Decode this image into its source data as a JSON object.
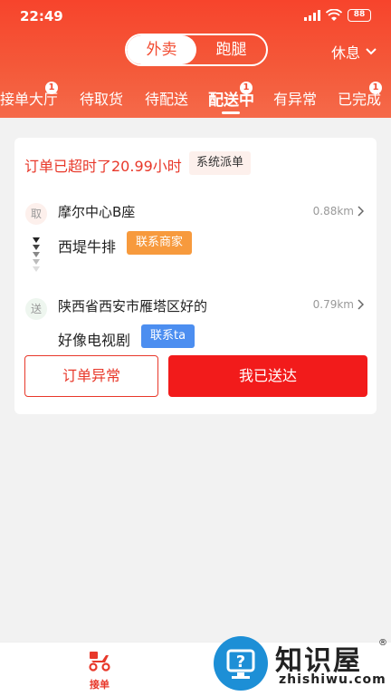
{
  "status_bar": {
    "time": "22:49",
    "battery": "88"
  },
  "header": {
    "segment": [
      {
        "label": "外卖",
        "active": true
      },
      {
        "label": "跑腿",
        "active": false
      }
    ],
    "rest_label": "休息"
  },
  "tabs": [
    {
      "label": "接单大厅",
      "badge": "1"
    },
    {
      "label": "待取货",
      "badge": ""
    },
    {
      "label": "待配送",
      "badge": ""
    },
    {
      "label": "配送中",
      "badge": "1",
      "active": true
    },
    {
      "label": "有异常",
      "badge": ""
    },
    {
      "label": "已完成",
      "badge": "1"
    }
  ],
  "order": {
    "overdue_text": "订单已超时了20.99小时",
    "dispatch_tag": "系统派单",
    "pickup": {
      "marker": "取",
      "address": "摩尔中心B座",
      "distance": "0.88km",
      "name": "西堤牛排",
      "contact_label": "联系商家"
    },
    "delivery": {
      "marker": "送",
      "address": "陕西省西安市雁塔区好的",
      "distance": "0.79km",
      "name": "好像电视剧",
      "contact_label": "联系ta"
    },
    "exception_button": "订单异常",
    "delivered_button": "我已送达"
  },
  "bottom_nav": {
    "label": "接单"
  },
  "watermark": {
    "title": "知识屋",
    "url": "zhishiwu.com",
    "reg": "®"
  },
  "colors": {
    "accent": "#f24c32",
    "primary_button": "#f21b1b",
    "merchant": "#f79a3d",
    "contact": "#4c8ef0"
  }
}
